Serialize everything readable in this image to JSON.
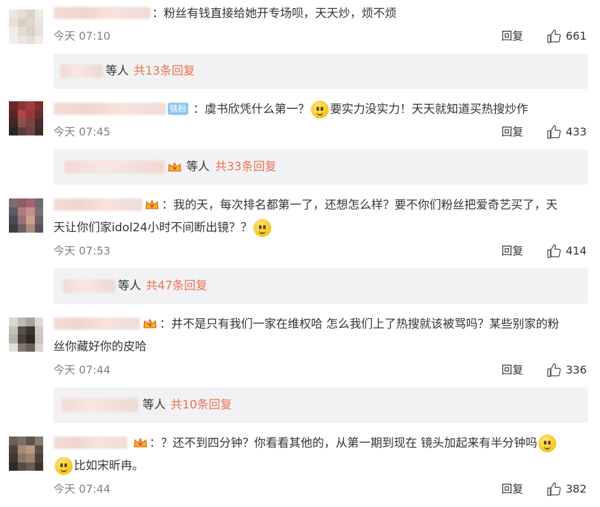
{
  "comments": [
    {
      "text": "：粉丝有钱直接给她开专场呗，天天炒，烦不烦",
      "time": "今天 07:10",
      "reply_label": "回复",
      "likes": "661",
      "has_replies": true,
      "replies_etc": "等人",
      "replies_total": "共13条回复",
      "avatar_colors": [
        "#ece7e0",
        "#e3ddd4",
        "#d9d2c7",
        "#eee9e2",
        "#e6e0d7",
        "#d5cec3",
        "#ddd7cd",
        "#e9e4dd",
        "#f0ece6",
        "#e1dbd2",
        "#d8d1c6",
        "#e7e1d9",
        "#f2efea",
        "#ebe6df",
        "#e4ded6",
        "#efebe5"
      ]
    },
    {
      "badge": "铁粉",
      "text_parts": [
        "：虞书欣凭什么第一？",
        "要实力没实力！天天就知道买热搜炒作"
      ],
      "time": "今天 07:45",
      "reply_label": "回复",
      "likes": "433",
      "has_replies": true,
      "replies_etc": "等人",
      "replies_total": "共33条回复",
      "avatar_colors": [
        "#6b2a2a",
        "#8c3535",
        "#a03c3c",
        "#7a2e2e",
        "#5a2626",
        "#b04545",
        "#9a3838",
        "#6e2b2b",
        "#3d2626",
        "#8a5050",
        "#7e4040",
        "#4a2b2b",
        "#2e2222",
        "#5c3a3a",
        "#704242",
        "#3b2828"
      ]
    },
    {
      "text_line1": "：我的天，每次排名都第一了，还想怎么样？要不你们粉丝把爱奇艺买了，天",
      "text_line2": "天让你们家idol24小时不间断出镜？？",
      "time": "今天 07:53",
      "reply_label": "回复",
      "likes": "414",
      "has_replies": true,
      "replies_etc": "等人",
      "replies_total": "共47条回复",
      "avatar_colors": [
        "#7a6e72",
        "#8e5a66",
        "#a4636f",
        "#6d6a6f",
        "#5e5a60",
        "#b07a83",
        "#c28d8e",
        "#7f7078",
        "#4c4a55",
        "#8f7576",
        "#c9a08e",
        "#6b5f66",
        "#3e3d48",
        "#6e6168",
        "#a98a7c",
        "#565159"
      ]
    },
    {
      "text_line1": "：并不是只有我们一家在维权哈 怎么我们上了热搜就该被骂吗？某些别家的粉",
      "text_line2": "丝你藏好你的皮哈",
      "time": "今天 07:44",
      "reply_label": "回复",
      "likes": "336",
      "has_replies": true,
      "replies_etc": "等人",
      "replies_total": "共10条回复",
      "avatar_colors": [
        "#d8d6d2",
        "#bcb8b2",
        "#a9a39c",
        "#dcdad6",
        "#c4c0ba",
        "#5a514a",
        "#3e3630",
        "#cfccc7",
        "#b7b3ad",
        "#4a413a",
        "#2e2823",
        "#c9c6c1",
        "#e2e0dc",
        "#807870",
        "#6a625a",
        "#d6d4cf"
      ]
    },
    {
      "text_line1": "：？还不到四分钟？你看看其他的，从第一期到现在 镜头加起来有半分钟吗",
      "text_line2": "比如宋昕冉。",
      "time": "今天 07:44",
      "reply_label": "回复",
      "likes": "382",
      "has_replies": false,
      "avatar_colors": [
        "#6a6058",
        "#7d7066",
        "#5e544c",
        "#877a6f",
        "#4c433c",
        "#a48b78",
        "#b89a84",
        "#5b5048",
        "#3d3631",
        "#8c7563",
        "#9c8270",
        "#4a413a",
        "#2f2a26",
        "#574c44",
        "#6a5c50",
        "#3a332e"
      ]
    }
  ],
  "colors": {
    "link": "#eb7350",
    "reply_bg": "#f2f2f5",
    "muted": "#808080",
    "badge": "#8ec7f3"
  },
  "icons": {
    "like": "thumbs-up-icon",
    "vip": "crown-vip-icon",
    "emoji": "smiley-emoji-icon"
  }
}
